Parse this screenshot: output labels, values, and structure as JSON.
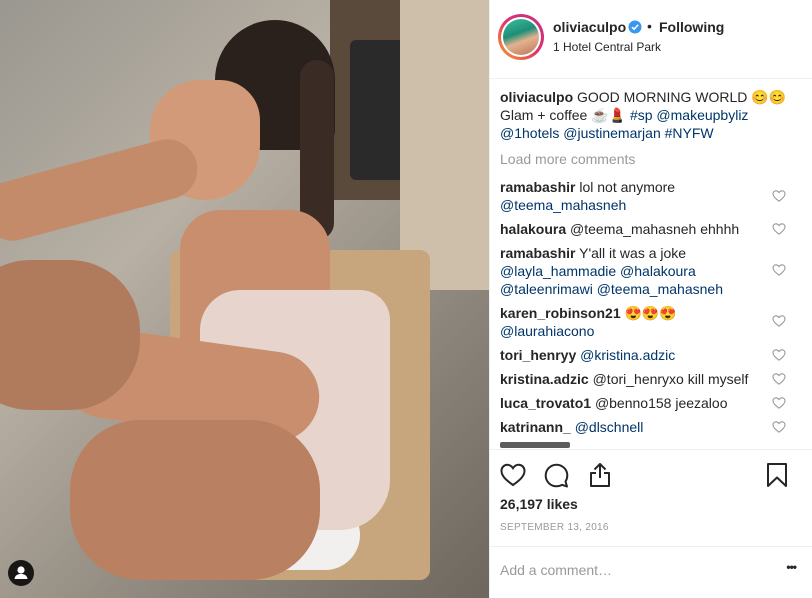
{
  "post": {
    "username": "oliviaculpo",
    "verified_icon": "verified-badge-icon",
    "separator": "•",
    "follow_status": "Following",
    "location": "1 Hotel Central Park",
    "caption": {
      "username": "oliviaculpo",
      "text_line1": "GOOD MORNING WORLD 😊😊",
      "text_line2a": "Glam + coffee ☕️💄",
      "tag_sp": "#sp",
      "mention_makeupbyliz": "@makeupbyliz",
      "mention_1hotels": "@1hotels",
      "mention_justinemarjan": "@justinemarjan",
      "tag_nyfw": "#NYFW"
    },
    "load_more": "Load more comments",
    "comments": [
      {
        "user": "ramabashir",
        "text": "lol not anymore",
        "line2": "@teema_mahasneh"
      },
      {
        "user": "halakoura",
        "text": "@teema_mahasneh ehhhh"
      },
      {
        "user": "ramabashir",
        "text": "Y'all it was a joke",
        "line2": "@layla_hammadie @halakoura",
        "line3": "@taleenrimawi @teema_mahasneh"
      },
      {
        "user": "karen_robinson21",
        "text": "😍😍😍",
        "line2": "@laurahiacono"
      },
      {
        "user": "tori_henryy",
        "text": "@kristina.adzic"
      },
      {
        "user": "kristina.adzic",
        "text": "@tori_henryxo kill myself"
      },
      {
        "user": "luca_trovato1",
        "text": "@benno158 jeezaloo"
      },
      {
        "user": "katrinann_",
        "text": "@dlschnell"
      }
    ],
    "likes": "26,197 likes",
    "date": "SEPTEMBER 13, 2016",
    "comment_placeholder": "Add a comment…",
    "more_icon": "•••"
  },
  "icons": {
    "heart": "heart-icon",
    "comment": "comment-icon",
    "share": "share-icon",
    "save": "bookmark-icon",
    "tag": "user-tag-icon"
  }
}
